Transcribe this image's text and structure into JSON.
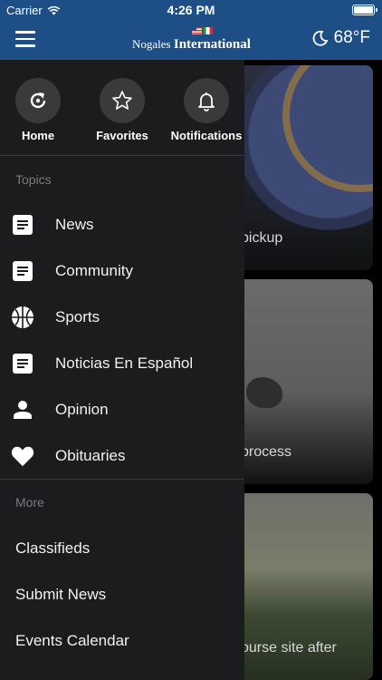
{
  "status_bar": {
    "carrier": "Carrier",
    "time": "4:26 PM"
  },
  "header": {
    "logo_part1": "Nogales ",
    "logo_part2": "International",
    "weather_temp": "68°F",
    "weather_icon": "moon-icon",
    "menu_icon": "hamburger-icon"
  },
  "quick_links": [
    {
      "label": "Home",
      "icon": "refresh-home-icon"
    },
    {
      "label": "Favorites",
      "icon": "star-icon"
    },
    {
      "label": "Notifications",
      "icon": "bell-icon"
    }
  ],
  "topics": {
    "heading": "Topics",
    "items": [
      {
        "label": "News",
        "icon": "document-icon"
      },
      {
        "label": "Community",
        "icon": "document-icon"
      },
      {
        "label": "Sports",
        "icon": "basketball-icon"
      },
      {
        "label": "Noticias En Español",
        "icon": "document-icon"
      },
      {
        "label": "Opinion",
        "icon": "person-icon"
      },
      {
        "label": "Obituaries",
        "icon": "heart-icon"
      }
    ]
  },
  "more": {
    "heading": "More",
    "items": [
      {
        "label": "Classifieds"
      },
      {
        "label": "Submit News"
      },
      {
        "label": "Events Calendar"
      }
    ]
  },
  "cards": [
    {
      "caption": "pickup"
    },
    {
      "caption": "process"
    },
    {
      "caption": "ourse site after"
    }
  ],
  "colors": {
    "header_bg": "#1d4f86",
    "drawer_bg": "#1c1c1e",
    "icon_circle": "#3a3a3c",
    "section_heading": "#7a7a7e"
  }
}
